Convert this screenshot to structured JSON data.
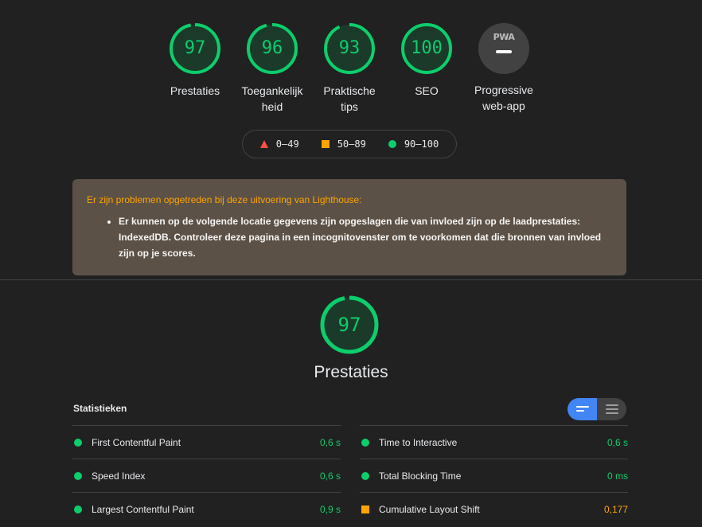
{
  "categories": [
    {
      "score": "97",
      "label": "Prestaties",
      "score_fraction": 0.97
    },
    {
      "score": "96",
      "label": "Toegankelijk heid",
      "score_fraction": 0.96
    },
    {
      "score": "93",
      "label": "Praktische tips",
      "score_fraction": 0.93
    },
    {
      "score": "100",
      "label": "SEO",
      "score_fraction": 1.0
    },
    {
      "badge": "PWA",
      "label": "Progressive web-app"
    }
  ],
  "legend": {
    "fail": "0–49",
    "average": "50–89",
    "pass": "90–100"
  },
  "warning": {
    "title": "Er zijn problemen opgetreden bij deze uitvoering van Lighthouse:",
    "item": "Er kunnen op de volgende locatie gegevens zijn opgeslagen die van invloed zijn op de laadprestaties: IndexedDB. Controleer deze pagina in een incognitovenster om te voorkomen dat die bronnen van invloed zijn op je scores."
  },
  "performance": {
    "score": "97",
    "score_fraction": 0.97,
    "title": "Prestaties"
  },
  "stats": {
    "header": "Statistieken",
    "left": [
      {
        "name": "First Contentful Paint",
        "value": "0,6 s",
        "rating": "pass"
      },
      {
        "name": "Speed Index",
        "value": "0,6 s",
        "rating": "pass"
      },
      {
        "name": "Largest Contentful Paint",
        "value": "0,9 s",
        "rating": "pass"
      }
    ],
    "right": [
      {
        "name": "Time to Interactive",
        "value": "0,6 s",
        "rating": "pass"
      },
      {
        "name": "Total Blocking Time",
        "value": "0 ms",
        "rating": "pass"
      },
      {
        "name": "Cumulative Layout Shift",
        "value": "0,177",
        "rating": "average"
      }
    ]
  },
  "colors": {
    "pass": "#0cce6b",
    "average": "#ffa400",
    "fail": "#ff4e42",
    "background": "#212121",
    "warning_bg": "#5b5146"
  }
}
